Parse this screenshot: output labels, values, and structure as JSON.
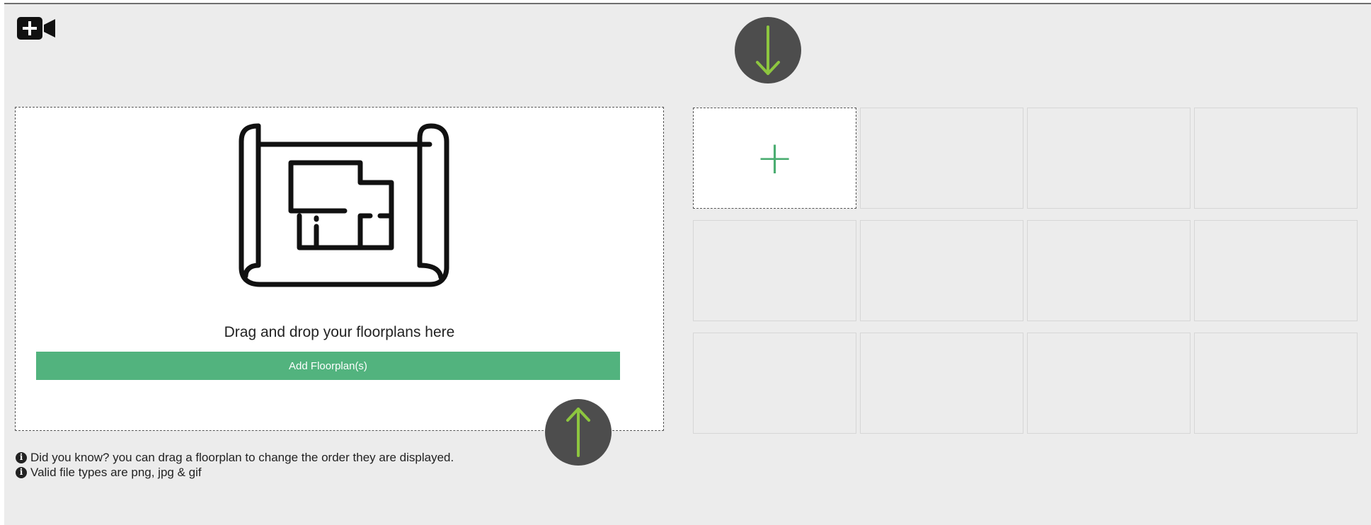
{
  "header": {
    "add_video_icon": "video-add-icon"
  },
  "upload": {
    "drop_text": "Drag and drop your floorplans here",
    "add_button_label": "Add Floorplan(s)",
    "illustration_icon": "floorplan-blueprint-icon"
  },
  "tips": [
    {
      "icon": "info-icon",
      "glyph": "i",
      "text": "Did you know? you can drag a floorplan to change the order they are displayed."
    },
    {
      "icon": "info-icon",
      "glyph": "i",
      "text": "Valid file types are png, jpg & gif"
    }
  ],
  "grid": {
    "add_symbol": "+",
    "slot_count": 12
  },
  "overlays": {
    "down_arrow_icon": "arrow-down-icon",
    "up_arrow_icon": "arrow-up-icon"
  },
  "colors": {
    "accent_green": "#52b37e",
    "arrow_green": "#8dc63f",
    "arrow_circle": "#4d4d4d",
    "background": "#ececec"
  }
}
